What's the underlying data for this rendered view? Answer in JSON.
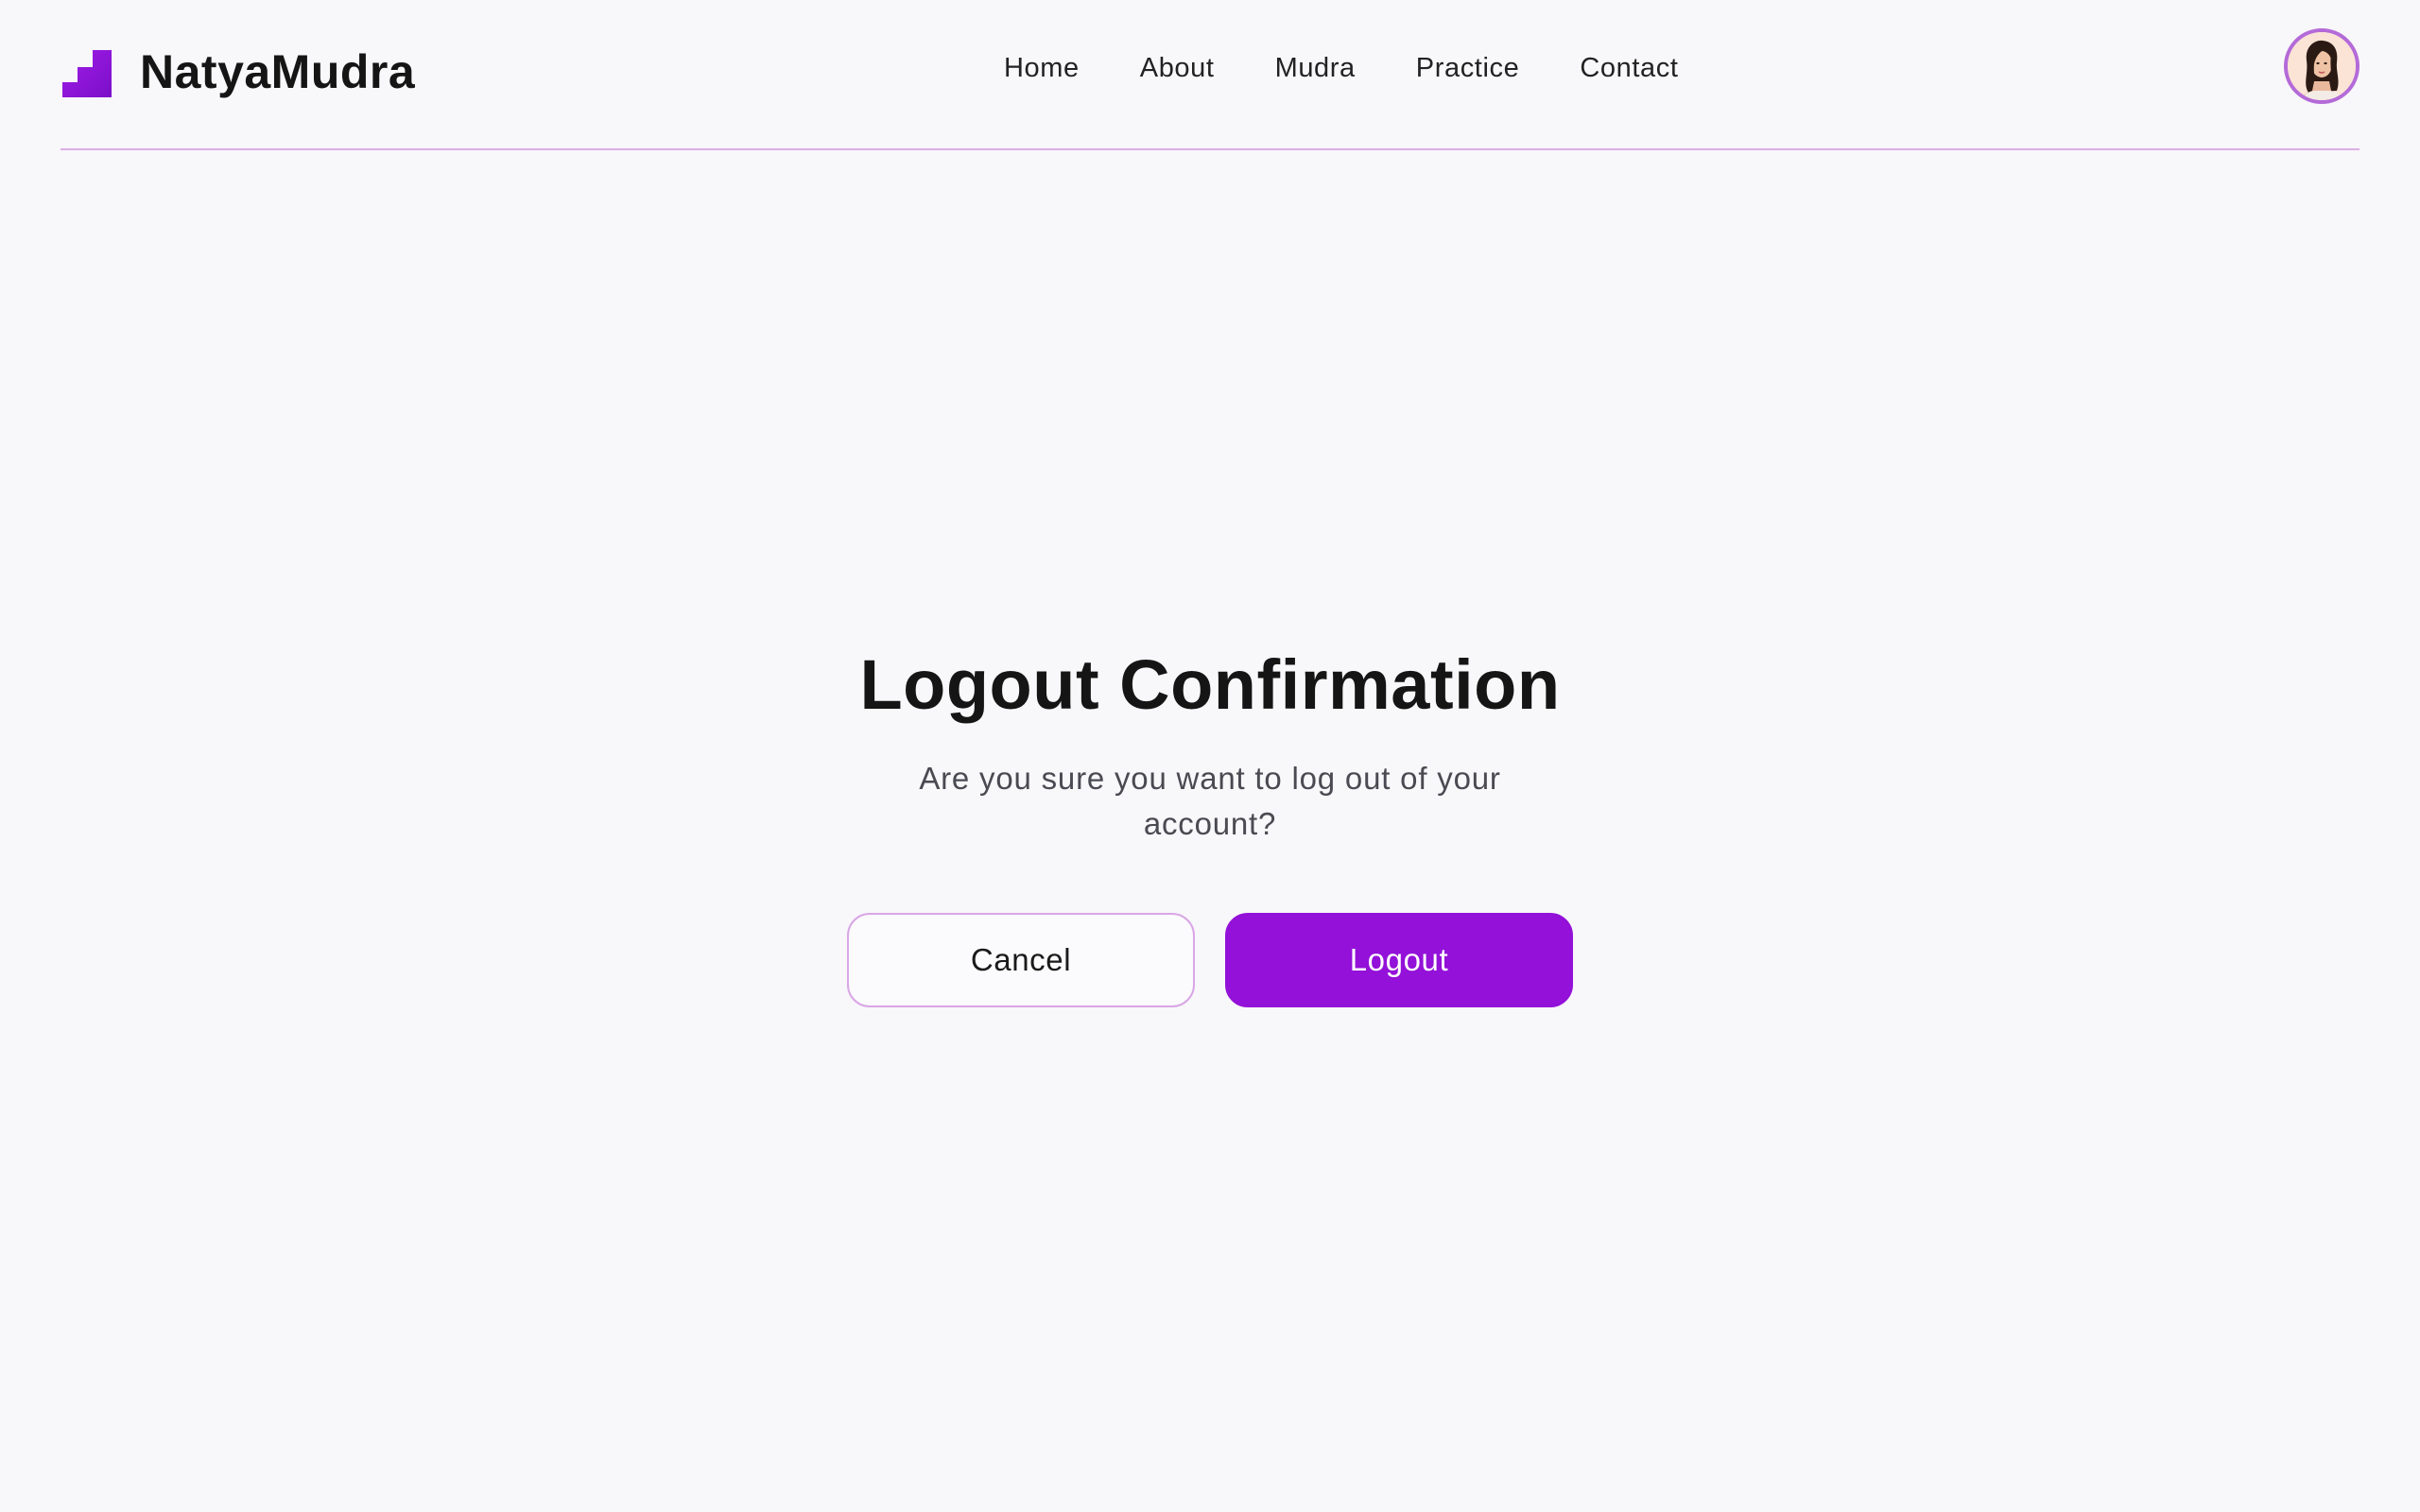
{
  "header": {
    "brand_name": "NatyaMudra",
    "nav": [
      {
        "label": "Home"
      },
      {
        "label": "About"
      },
      {
        "label": "Mudra"
      },
      {
        "label": "Practice"
      },
      {
        "label": "Contact"
      }
    ],
    "avatar_icon": "user-avatar"
  },
  "dialog": {
    "title": "Logout Confirmation",
    "message": "Are you sure you want to log out of your account?",
    "cancel_label": "Cancel",
    "logout_label": "Logout"
  },
  "colors": {
    "accent": "#9311d8",
    "background": "#f8f7fa",
    "divider": "#dcaee6",
    "text": "#151515"
  }
}
